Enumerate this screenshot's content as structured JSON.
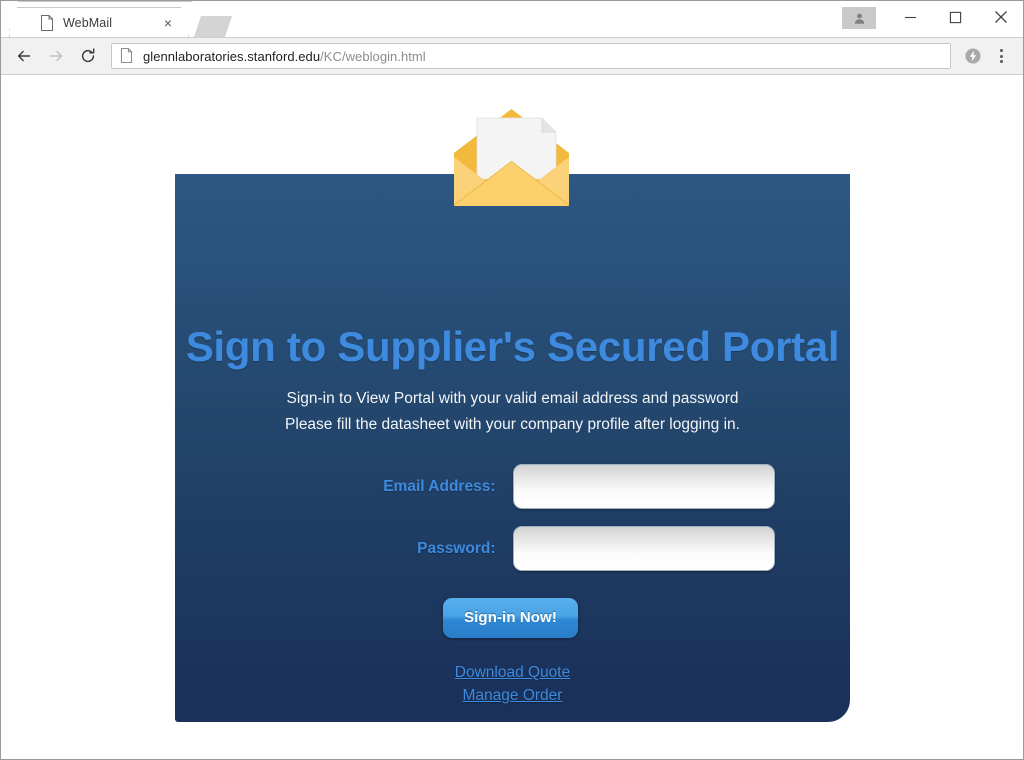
{
  "browser": {
    "tab": {
      "title": "WebMail",
      "favicon_icon": "page-icon",
      "close_icon": "close-icon"
    },
    "new_tab_icon": "new-tab-button",
    "window_controls": {
      "profile_icon": "person-icon",
      "minimize_label": "–",
      "maximize_label": "□",
      "close_label": "×"
    },
    "toolbar": {
      "back_icon": "back-arrow-icon",
      "forward_icon": "forward-arrow-icon",
      "reload_icon": "reload-icon",
      "page_icon": "page-info-icon",
      "url_host": "glennlaboratories.stanford.edu",
      "url_path": "/KC/weblogin.html",
      "extension_icon": "lightning-bolt-icon",
      "menu_icon": "three-dot-menu-icon"
    }
  },
  "page": {
    "envelope_icon": "open-envelope-with-letter-icon",
    "title": "Sign to Supplier's Secured Portal",
    "subtitle_line1": "Sign-in to View Portal with your valid email address and password",
    "subtitle_line2": "Please fill the datasheet with your company profile after logging in.",
    "fields": [
      {
        "label": "Email Address:",
        "value": "",
        "placeholder": ""
      },
      {
        "label": "Password:",
        "value": "",
        "placeholder": ""
      }
    ],
    "submit_label": "Sign-in Now!",
    "links": [
      {
        "label": "Download Quote"
      },
      {
        "label": "Manage Order"
      }
    ],
    "colors": {
      "panel_top": "#2d5883",
      "panel_bottom": "#1a3159",
      "accent_blue": "#3d8ade",
      "button_blue": "#4aa3e6",
      "envelope_yellow": "#f7c04a"
    }
  }
}
